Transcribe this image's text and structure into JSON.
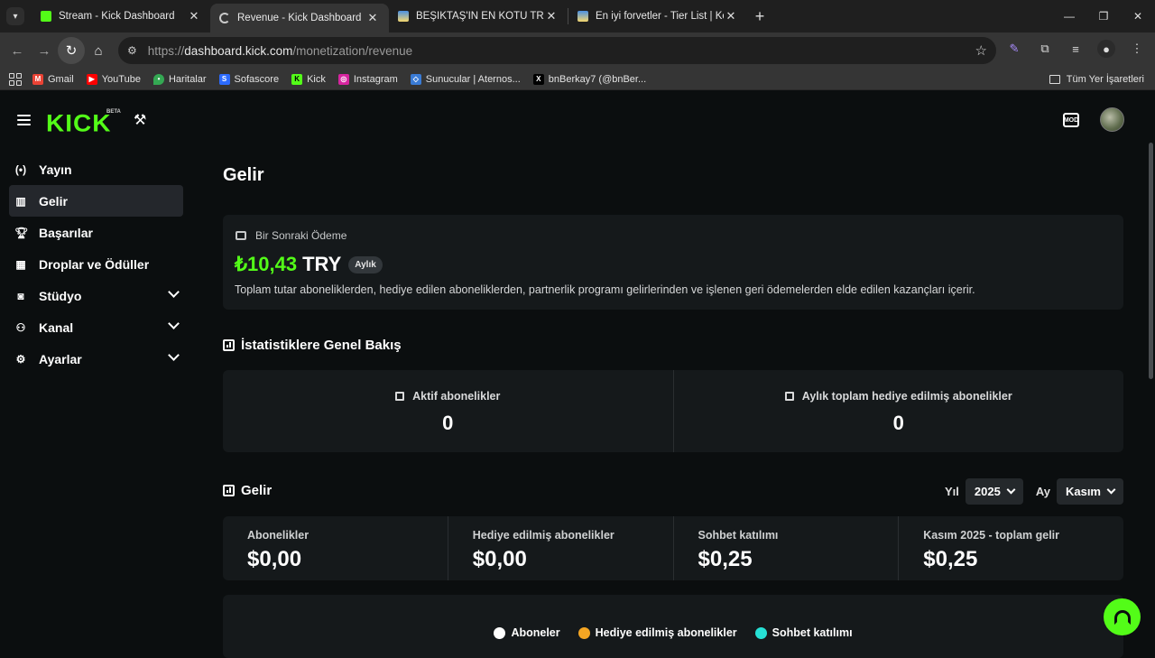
{
  "browser": {
    "tabs": [
      {
        "title": "Stream - Kick Dashboard",
        "active": false
      },
      {
        "title": "Revenue - Kick Dashboard",
        "active": true
      },
      {
        "title": "BEŞİKTAŞ'IN EN KÖTÜ TRANSFE",
        "active": false
      },
      {
        "title": "En iyi forvetler - Tier List | Kör S",
        "active": false
      }
    ],
    "url_prefix": "https://",
    "url_host": "dashboard.kick.com",
    "url_path": "/monetization/revenue",
    "bookmarks": [
      {
        "label": "Gmail",
        "icon": "gmail-icon",
        "color": "#ea4335"
      },
      {
        "label": "YouTube",
        "icon": "youtube-icon",
        "color": "#ff0000"
      },
      {
        "label": "Haritalar",
        "icon": "maps-icon",
        "color": "#34a853"
      },
      {
        "label": "Sofascore",
        "icon": "sofascore-icon",
        "color": "#2c6bff"
      },
      {
        "label": "Kick",
        "icon": "kick-icon",
        "color": "#53fc18"
      },
      {
        "label": "Instagram",
        "icon": "instagram-icon",
        "color": "#d6249f"
      },
      {
        "label": "Sunucular | Aternos...",
        "icon": "aternos-icon",
        "color": "#3a7bd5"
      },
      {
        "label": "bnBerkay7 (@bnBer...",
        "icon": "x-icon",
        "color": "#000000"
      }
    ],
    "all_bookmarks": "Tüm Yer İşaretleri"
  },
  "header": {
    "logo": "KICK",
    "beta": "BETA"
  },
  "sidebar": {
    "items": [
      {
        "label": "Yayın",
        "icon": "broadcast-icon",
        "active": false,
        "expandable": false
      },
      {
        "label": "Gelir",
        "icon": "revenue-icon",
        "active": true,
        "expandable": false
      },
      {
        "label": "Başarılar",
        "icon": "trophy-icon",
        "active": false,
        "expandable": false
      },
      {
        "label": "Droplar ve Ödüller",
        "icon": "gift-icon",
        "active": false,
        "expandable": false
      },
      {
        "label": "Stüdyo",
        "icon": "studio-icon",
        "active": false,
        "expandable": true
      },
      {
        "label": "Kanal",
        "icon": "channel-icon",
        "active": false,
        "expandable": true
      },
      {
        "label": "Ayarlar",
        "icon": "settings-icon",
        "active": false,
        "expandable": true
      }
    ]
  },
  "main": {
    "title": "Gelir",
    "payout": {
      "label": "Bir Sonraki Ödeme",
      "amount": "₺10,43",
      "currency": "TRY",
      "badge": "Aylık",
      "description": "Toplam tutar aboneliklerden, hediye edilen aboneliklerden, partnerlik programı gelirlerinden ve işlenen geri ödemelerden elde edilen kazançları içerir."
    },
    "stats_title": "İstatistiklere Genel Bakış",
    "stats": [
      {
        "label": "Aktif abonelikler",
        "value": "0"
      },
      {
        "label": "Aylık toplam hediye edilmiş abonelikler",
        "value": "0"
      }
    ],
    "revenue_title": "Gelir",
    "filters": {
      "year_label": "Yıl",
      "year_value": "2025",
      "month_label": "Ay",
      "month_value": "Kasım"
    },
    "revenue": [
      {
        "label": "Abonelikler",
        "value": "$0,00"
      },
      {
        "label": "Hediye edilmiş abonelikler",
        "value": "$0,00"
      },
      {
        "label": "Sohbet katılımı",
        "value": "$0,25"
      },
      {
        "label": "Kasım 2025 - toplam gelir",
        "value": "$0,25"
      }
    ],
    "legend": [
      {
        "label": "Aboneler",
        "color": "#ffffff"
      },
      {
        "label": "Hediye edilmiş abonelikler",
        "color": "#f5a623"
      },
      {
        "label": "Sohbet katılımı",
        "color": "#26e0d5"
      }
    ]
  },
  "colors": {
    "accent": "#53fc18",
    "background": "#0b0e0f",
    "card": "#15191b"
  }
}
